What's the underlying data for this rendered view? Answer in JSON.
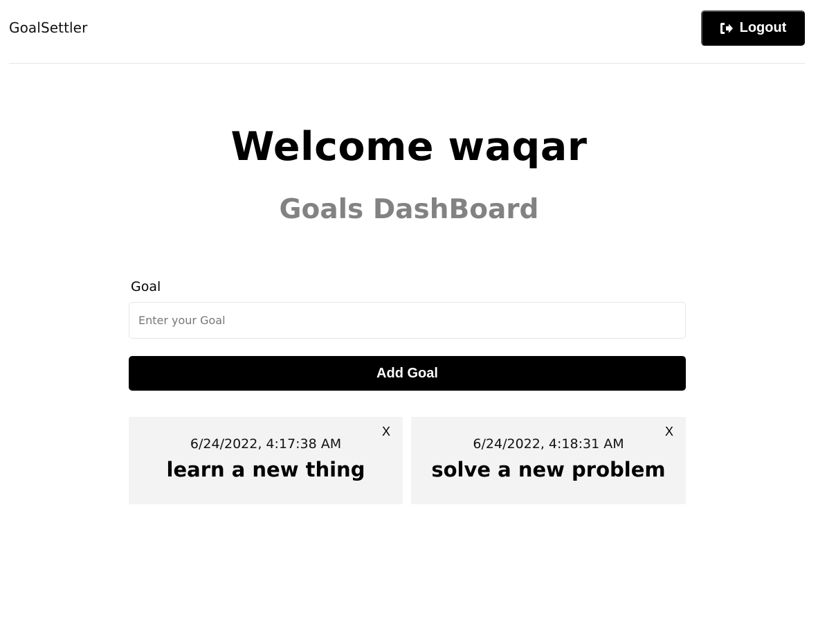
{
  "header": {
    "brand": "GoalSettler",
    "logout_label": "Logout",
    "logout_icon": "sign-out-icon"
  },
  "main": {
    "welcome": "Welcome waqar",
    "subtitle": "Goals DashBoard"
  },
  "form": {
    "goal_label": "Goal",
    "goal_placeholder": "Enter your Goal",
    "goal_value": "",
    "add_button_label": "Add Goal"
  },
  "goals": [
    {
      "date": "6/24/2022, 4:17:38 AM",
      "text": "learn a new thing",
      "close_label": "X"
    },
    {
      "date": "6/24/2022, 4:18:31 AM",
      "text": "solve a new problem",
      "close_label": "X"
    }
  ],
  "colors": {
    "primary": "#000000",
    "subtitle": "#828282",
    "card_background": "#f3f3f3",
    "divider": "#e6e6e6"
  }
}
